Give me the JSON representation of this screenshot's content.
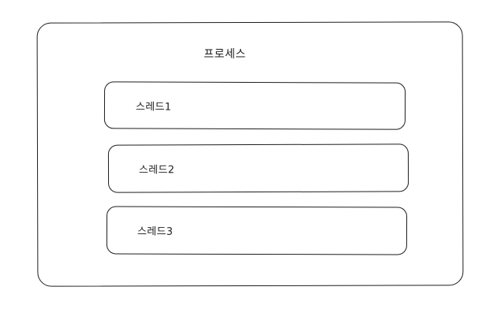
{
  "process": {
    "label": "프로세스"
  },
  "threads": [
    {
      "label": "스레드1"
    },
    {
      "label": "스레드2"
    },
    {
      "label": "스레드3"
    }
  ],
  "colors": {
    "stroke": "#1e1e1e",
    "background": "#ffffff"
  }
}
